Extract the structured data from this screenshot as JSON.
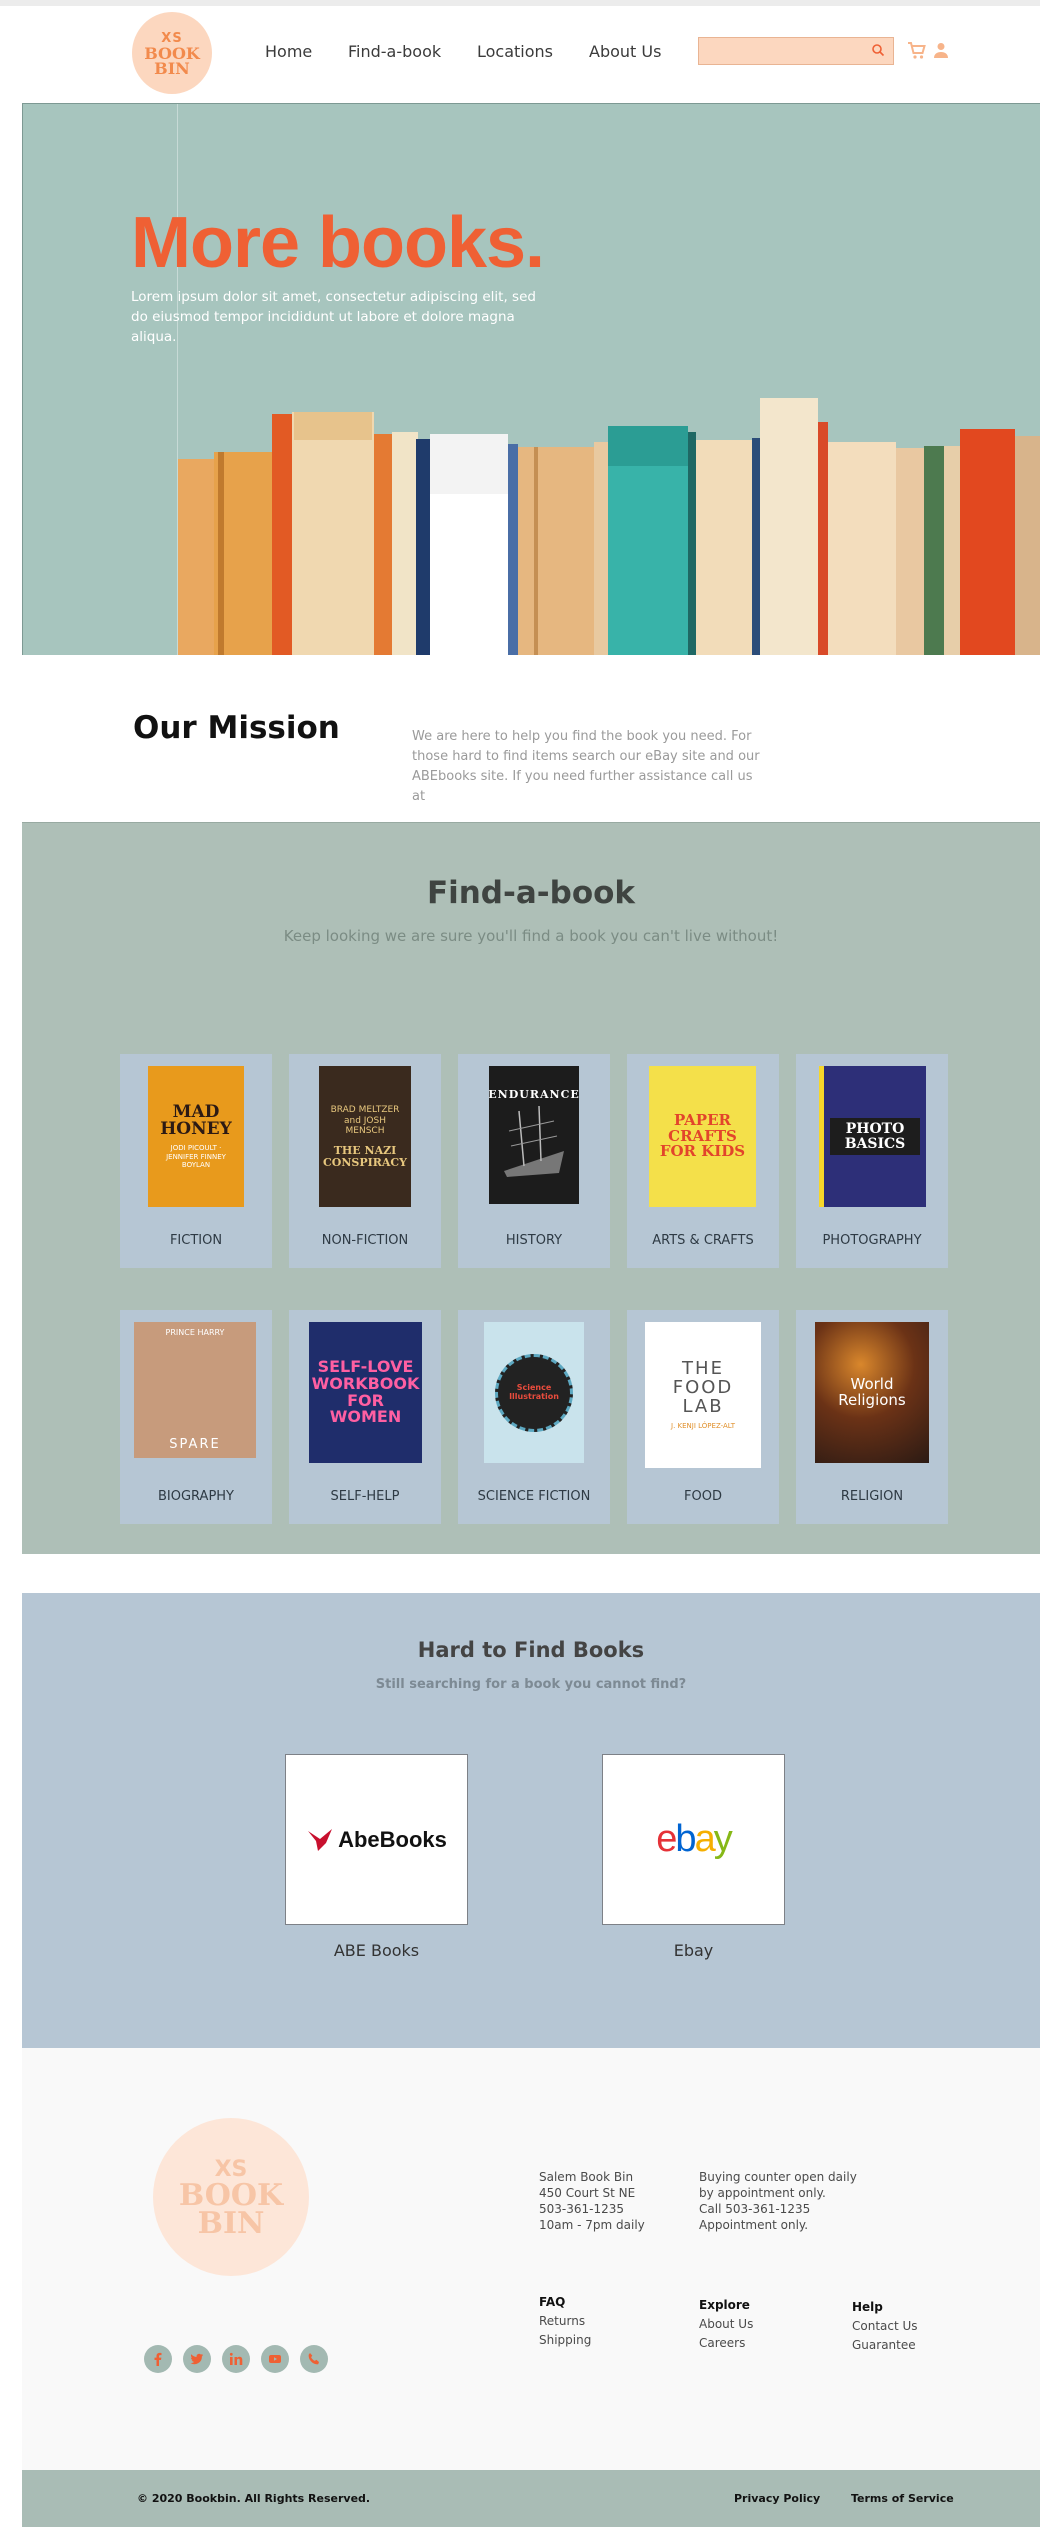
{
  "header": {
    "logo": {
      "top": "XS",
      "mid": "BOOK",
      "bot": "BIN"
    },
    "nav": [
      {
        "label": "Home"
      },
      {
        "label": "Find-a-book"
      },
      {
        "label": "Locations"
      },
      {
        "label": "About Us"
      }
    ],
    "search_placeholder": "",
    "colors": {
      "accent": "#ef6034",
      "search_bg": "#fcd7bf"
    }
  },
  "hero": {
    "title": "More books.",
    "body": "Lorem ipsum dolor sit amet, consectetur adipiscing elit, sed do eiusmod tempor incididunt ut labore et dolore magna aliqua."
  },
  "mission": {
    "title": "Our Mission",
    "text": "We are here to help you find the book you need. For those hard to find items search our eBay site and our ABEbooks site. If you need further assistance call us at"
  },
  "find": {
    "title": "Find-a-book",
    "subtitle": "Keep looking we are sure you'll find a book you can't live without!",
    "categories": [
      {
        "label": "FICTION",
        "cover_title": "MAD HONEY",
        "cover_sub": "JODI PICOULT · JENNIFER FINNEY BOYLAN",
        "bg": "#e89a1c",
        "fg": "#ffffff"
      },
      {
        "label": "NON-FICTION",
        "cover_title": "THE NAZI CONSPIRACY",
        "cover_sub": "BRAD MELTZER and JOSH MENSCH",
        "bg": "#3a2a1e",
        "fg": "#e7c77e"
      },
      {
        "label": "HISTORY",
        "cover_title": "ENDURANCE",
        "cover_sub": "",
        "bg": "#1c1c1c",
        "fg": "#ffffff"
      },
      {
        "label": "ARTS & CRAFTS",
        "cover_title": "PAPER CRAFTS FOR KIDS",
        "cover_sub": "",
        "bg": "#f4e04a",
        "fg": "#e2442b"
      },
      {
        "label": "PHOTOGRAPHY",
        "cover_title": "PHOTO BASICS",
        "cover_sub": "",
        "bg": "#2d2f78",
        "fg": "#ffffff"
      },
      {
        "label": "BIOGRAPHY",
        "cover_title": "SPARE",
        "cover_sub": "PRINCE HARRY",
        "bg": "#c79b7c",
        "fg": "#ffffff"
      },
      {
        "label": "SELF-HELP",
        "cover_title": "SELF-LOVE WORKBOOK FOR WOMEN",
        "cover_sub": "",
        "bg": "#1f2d6b",
        "fg": "#ff5fa2"
      },
      {
        "label": "SCIENCE FICTION",
        "cover_title": "Science Illustration",
        "cover_sub": "",
        "bg": "#c9e3ec",
        "fg": "#c9302c"
      },
      {
        "label": "FOOD",
        "cover_title": "THE FOOD LAB",
        "cover_sub": "J. KENJI LÓPEZ-ALT",
        "bg": "#ffffff",
        "fg": "#555555"
      },
      {
        "label": "RELIGION",
        "cover_title": "World Religions",
        "cover_sub": "",
        "bg": "#2b1a14",
        "fg": "#ffffff"
      }
    ]
  },
  "hard": {
    "title": "Hard to Find Books",
    "subtitle": "Still searching for a book you cannot find?",
    "partners": [
      {
        "label": "ABE Books",
        "logo_text": "AbeBooks"
      },
      {
        "label": "Ebay",
        "logo_text": "ebay"
      }
    ]
  },
  "footer": {
    "logo": {
      "top": "XS",
      "mid": "BOOK",
      "bot": "BIN"
    },
    "address": [
      "Salem Book Bin",
      "450 Court St NE",
      "503-361-1235",
      "10am - 7pm daily"
    ],
    "counter": [
      "Buying counter open daily",
      "by appointment only.",
      "Call 503-361-1235",
      "Appointment only."
    ],
    "faq": {
      "title": "FAQ",
      "links": [
        "Returns",
        "Shipping"
      ]
    },
    "explore": {
      "title": "Explore",
      "links": [
        "About Us",
        "Careers"
      ]
    },
    "help": {
      "title": "Help",
      "links": [
        "Contact Us",
        "Guarantee"
      ]
    },
    "social": [
      "facebook-icon",
      "twitter-icon",
      "linkedin-icon",
      "youtube-icon",
      "phone-icon"
    ],
    "copyright": "© 2020 Bookbin.  All Rights Reserved.",
    "privacy": "Privacy Policy",
    "terms": "Terms of Service"
  }
}
